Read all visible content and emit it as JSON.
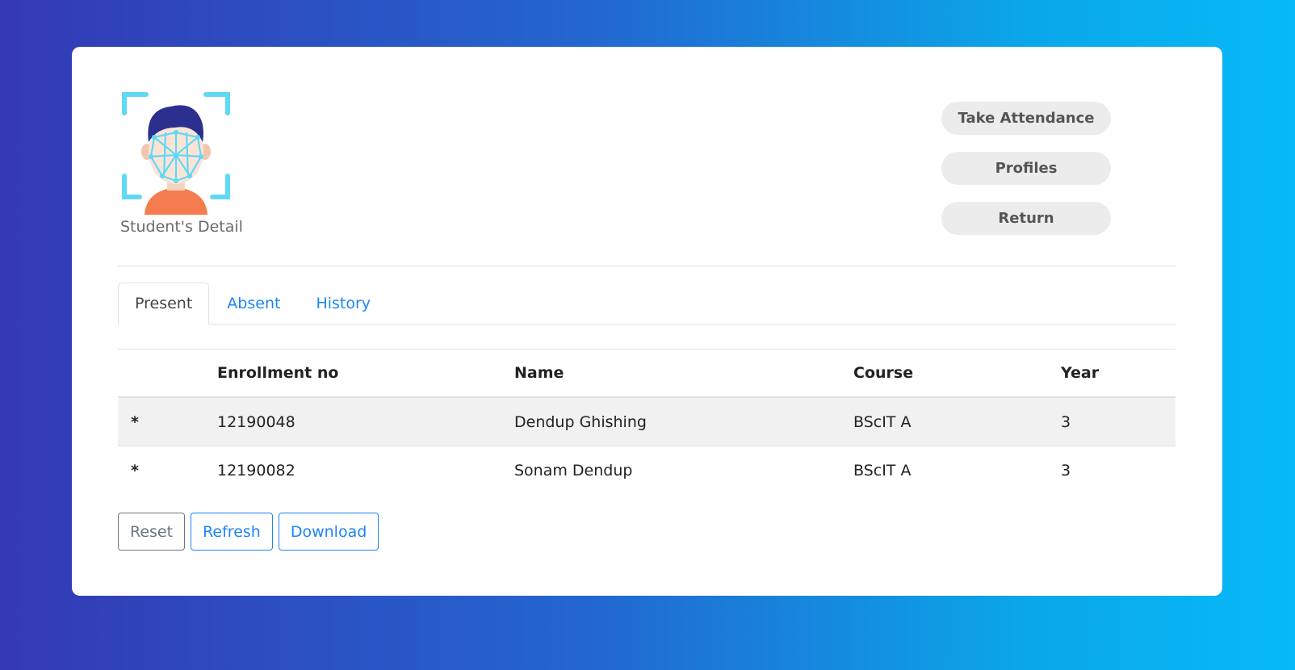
{
  "header": {
    "logo_caption": "Student's Detail"
  },
  "nav": {
    "take_attendance": "Take Attendance",
    "profiles": "Profiles",
    "return": "Return"
  },
  "tabs": [
    {
      "label": "Present",
      "active": true
    },
    {
      "label": "Absent",
      "active": false
    },
    {
      "label": "History",
      "active": false
    }
  ],
  "table": {
    "columns": [
      "",
      "Enrollment no",
      "Name",
      "Course",
      "Year"
    ],
    "rows": [
      {
        "marker": "*",
        "enrollment": "12190048",
        "name": "Dendup Ghishing",
        "course": "BScIT A",
        "year": "3"
      },
      {
        "marker": "*",
        "enrollment": "12190082",
        "name": "Sonam Dendup",
        "course": "BScIT A",
        "year": "3"
      }
    ]
  },
  "actions": {
    "reset": "Reset",
    "refresh": "Refresh",
    "download": "Download"
  },
  "colors": {
    "accent": "#1e84f5",
    "face_icon_cyan": "#5fd9f5",
    "face_icon_hair": "#2d2f8f",
    "face_icon_shirt": "#f57c4f"
  }
}
